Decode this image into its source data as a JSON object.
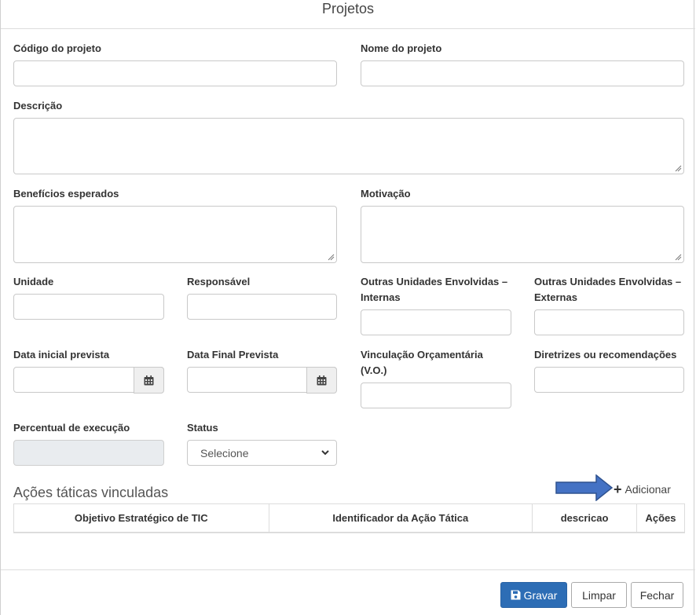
{
  "dialog": {
    "title": "Projetos"
  },
  "fields": {
    "codigo": {
      "label": "Código do projeto",
      "value": ""
    },
    "nome": {
      "label": "Nome do projeto",
      "value": ""
    },
    "descricao": {
      "label": "Descrição",
      "value": ""
    },
    "beneficios": {
      "label": "Benefícios esperados",
      "value": ""
    },
    "motivacao": {
      "label": "Motivação",
      "value": ""
    },
    "unidade": {
      "label": "Unidade",
      "value": ""
    },
    "responsavel": {
      "label": "Responsável",
      "value": ""
    },
    "outras_internas": {
      "label_line1": "Outras Unidades Envolvidas –",
      "label_line2": "Internas",
      "value": ""
    },
    "outras_externas": {
      "label_line1": "Outras Unidades Envolvidas –",
      "label_line2": "Externas",
      "value": ""
    },
    "data_inicial": {
      "label": "Data inicial prevista",
      "value": ""
    },
    "data_final": {
      "label": "Data Final Prevista",
      "value": ""
    },
    "vinculacao": {
      "label_line1": "Vinculação Orçamentária",
      "label_line2": "(V.O.)",
      "value": ""
    },
    "diretrizes": {
      "label": "Diretrizes ou recomendações",
      "value": ""
    },
    "percentual": {
      "label": "Percentual de execução",
      "value": ""
    },
    "status": {
      "label": "Status",
      "selected": "Selecione"
    }
  },
  "acoes": {
    "title": "Ações táticas vinculadas",
    "add_label": "Adicionar",
    "columns": [
      "Objetivo Estratégico de TIC",
      "Identificador da Ação Tática",
      "descricao",
      "Ações"
    ]
  },
  "footer": {
    "save_label": "Gravar",
    "clear_label": "Limpar",
    "close_label": "Fechar"
  },
  "colors": {
    "primary": "#2d6db5",
    "arrow": "#4472c4"
  }
}
